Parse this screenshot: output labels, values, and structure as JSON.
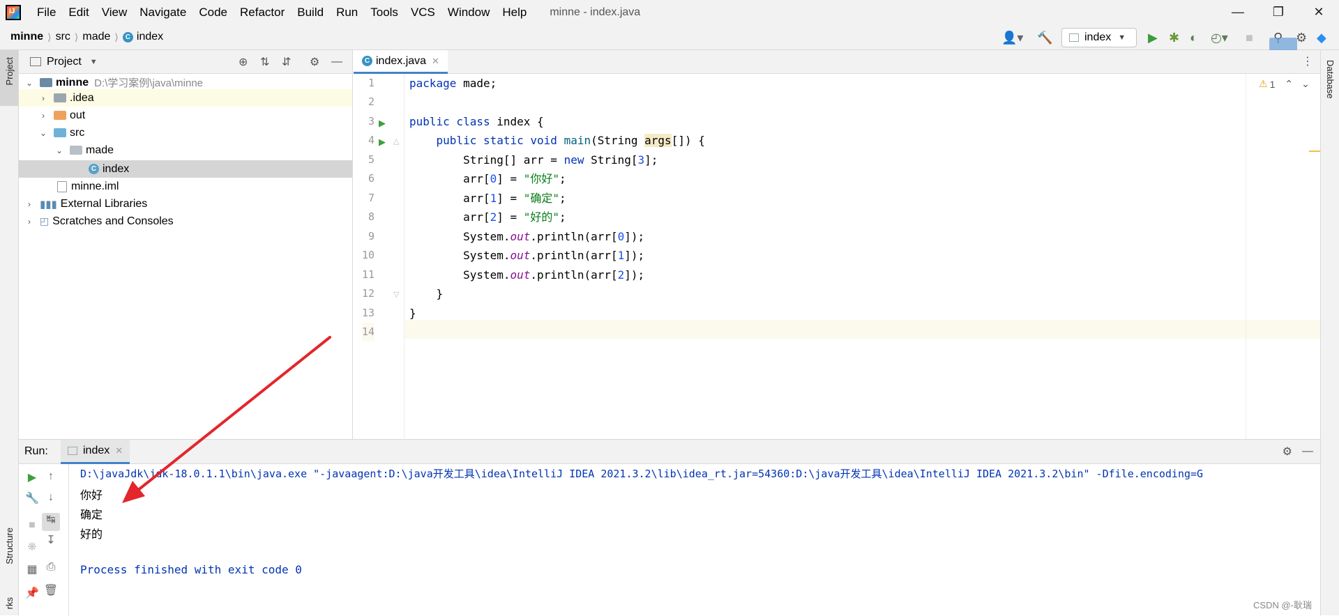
{
  "menu": [
    "File",
    "Edit",
    "View",
    "Navigate",
    "Code",
    "Refactor",
    "Build",
    "Run",
    "Tools",
    "VCS",
    "Window",
    "Help"
  ],
  "window_title": "minne - index.java",
  "breadcrumb": [
    "minne",
    "src",
    "made",
    "index"
  ],
  "run_config": "index",
  "side_tabs": {
    "project": "Project",
    "structure": "Structure",
    "bookmarks": "rks",
    "database": "Database"
  },
  "project_panel": {
    "title": "Project",
    "tree": [
      {
        "label": "minne",
        "path": "D:\\学习案例\\java\\minne",
        "depth": 0,
        "expanded": true,
        "kind": "module"
      },
      {
        "label": ".idea",
        "depth": 1,
        "expanded": false,
        "kind": "folder"
      },
      {
        "label": "out",
        "depth": 1,
        "expanded": false,
        "kind": "folder-orange"
      },
      {
        "label": "src",
        "depth": 1,
        "expanded": true,
        "kind": "folder-blue"
      },
      {
        "label": "made",
        "depth": 2,
        "expanded": true,
        "kind": "package"
      },
      {
        "label": "index",
        "depth": 3,
        "kind": "class"
      },
      {
        "label": "minne.iml",
        "depth": 1,
        "kind": "iml"
      },
      {
        "label": "External Libraries",
        "depth": 0,
        "expanded": false,
        "kind": "libs"
      },
      {
        "label": "Scratches and Consoles",
        "depth": 0,
        "expanded": false,
        "kind": "scratch"
      }
    ]
  },
  "editor": {
    "tab": "index.java",
    "warning_count": "1",
    "lines": [
      "1",
      "2",
      "3",
      "4",
      "5",
      "6",
      "7",
      "8",
      "9",
      "10",
      "11",
      "12",
      "13",
      "14"
    ]
  },
  "run_panel": {
    "label": "Run:",
    "tab": "index",
    "console": [
      "D:\\javaJdk\\jdk-18.0.1.1\\bin\\java.exe \"-javaagent:D:\\java开发工具\\idea\\IntelliJ IDEA 2021.3.2\\lib\\idea_rt.jar=54360:D:\\java开发工具\\idea\\IntelliJ IDEA 2021.3.2\\bin\" -Dfile.encoding=G",
      "你好",
      "确定",
      "好的",
      "",
      "Process finished with exit code 0"
    ]
  },
  "watermark": "CSDN @-耿瑞",
  "colors": {
    "keyword": "#0033b3",
    "string": "#067d17",
    "number": "#1750eb",
    "field": "#871094",
    "accent": "#4083c9",
    "arrow": "#e3262b"
  }
}
